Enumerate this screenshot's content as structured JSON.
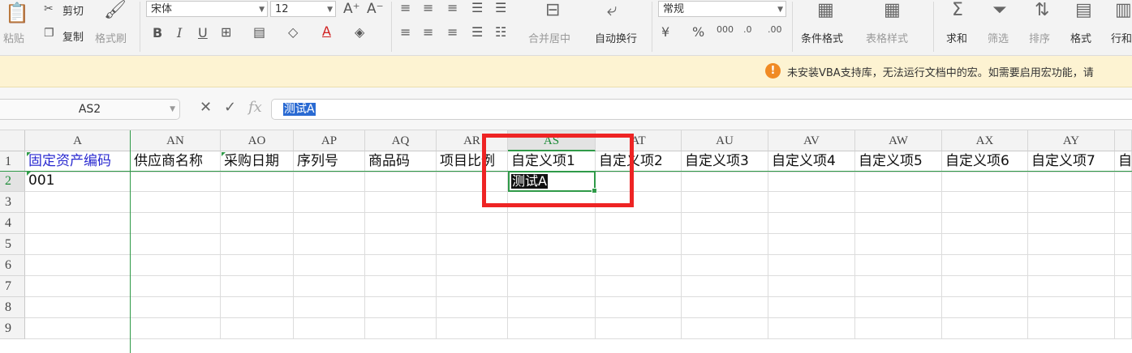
{
  "ribbon": {
    "paste": "粘贴",
    "cut": "剪切",
    "copy": "复制",
    "format_painter": "格式刷",
    "font_name": "宋体",
    "font_size": "12",
    "merge_center": "合并居中",
    "wrap_text": "自动换行",
    "number_format": "常规",
    "conditional_format": "条件格式",
    "table_style": "表格样式",
    "sum": "求和",
    "filter": "筛选",
    "sort": "排序",
    "format": "格式",
    "rows_cols": "行和"
  },
  "infobar": {
    "message": "未安装VBA支持库，无法运行文档中的宏。如需要启用宏功能，请"
  },
  "formula_bar": {
    "name_box": "AS2",
    "formula": "测试A"
  },
  "sheet": {
    "columns": [
      {
        "name": "A"
      },
      {
        "name": "AN"
      },
      {
        "name": "AO"
      },
      {
        "name": "AP"
      },
      {
        "name": "AQ"
      },
      {
        "name": "AR"
      },
      {
        "name": "AS"
      },
      {
        "name": "AT"
      },
      {
        "name": "AU"
      },
      {
        "name": "AV"
      },
      {
        "name": "AW"
      },
      {
        "name": "AX"
      },
      {
        "name": "AY"
      },
      {
        "name": ""
      }
    ],
    "rows": [
      "1",
      "2",
      "3",
      "4",
      "5",
      "6",
      "7",
      "8",
      "9"
    ],
    "header_row": [
      "固定资产编码",
      "供应商名称",
      "采购日期",
      "序列号",
      "商品码",
      "项目比例",
      "自定义项1",
      "自定义项2",
      "自定义项3",
      "自定义项4",
      "自定义项5",
      "自定义项6",
      "自定义项7",
      "自"
    ],
    "row2": [
      "001",
      "",
      "",
      "",
      "",
      "",
      "测试A",
      "",
      "",
      "",
      "",
      "",
      "",
      ""
    ]
  }
}
